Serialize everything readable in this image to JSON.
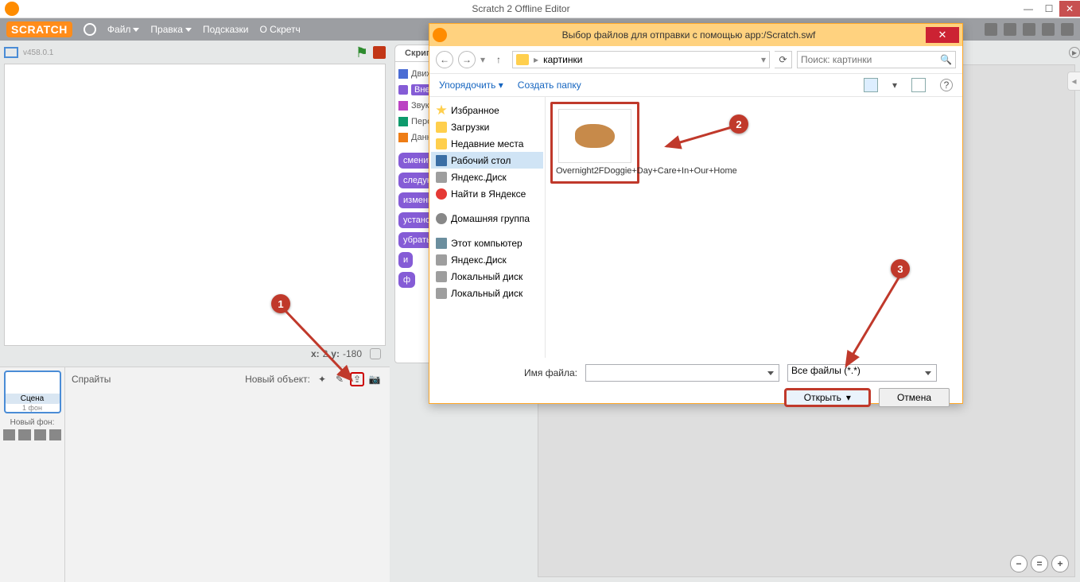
{
  "window": {
    "title": "Scratch 2 Offline Editor"
  },
  "menubar": {
    "logo": "SCRATCH",
    "file": "Файл",
    "edit": "Правка",
    "tips": "Подсказки",
    "about": "О Скретч"
  },
  "stage": {
    "version": "v458.0.1",
    "x_label": "x:",
    "x_val": "2",
    "y_label": "y:",
    "y_val": "-180"
  },
  "sprite_pane": {
    "stage_label": "Сцена",
    "stage_sub": "1 фон",
    "new_bg": "Новый фон:",
    "sprites_title": "Спрайты",
    "new_object": "Новый объект:"
  },
  "tabs": {
    "scripts": "Скрипты"
  },
  "categories": {
    "motion": "Движение",
    "looks": "Внешность",
    "sound": "Звук",
    "pen": "Перо",
    "data": "Данные"
  },
  "blocks": [
    "сменить",
    "следующий",
    "изменить",
    "установить",
    "убрать",
    "и",
    "ф"
  ],
  "dialog": {
    "title": "Выбор файлов для отправки с помощью app:/Scratch.swf",
    "breadcrumb": "картинки",
    "search_placeholder": "Поиск: картинки",
    "organize": "Упорядочить",
    "new_folder": "Создать папку",
    "tree": {
      "fav": "Избранное",
      "dl": "Загрузки",
      "recent": "Недавние места",
      "desktop": "Рабочий стол",
      "yadisk": "Яндекс.Диск",
      "yasearch": "Найти в Яндексе",
      "homegroup": "Домашняя группа",
      "pc": "Этот компьютер",
      "yadisk2": "Яндекс.Диск",
      "ldisk1": "Локальный диск",
      "ldisk2": "Локальный диск"
    },
    "file_name": "Overnight2FDoggie+Day+Care+In+Our+Home",
    "fn_label": "Имя файла:",
    "filter": "Все файлы (*.*)",
    "open": "Открыть",
    "cancel": "Отмена"
  },
  "callouts": {
    "c1": "1",
    "c2": "2",
    "c3": "3"
  }
}
